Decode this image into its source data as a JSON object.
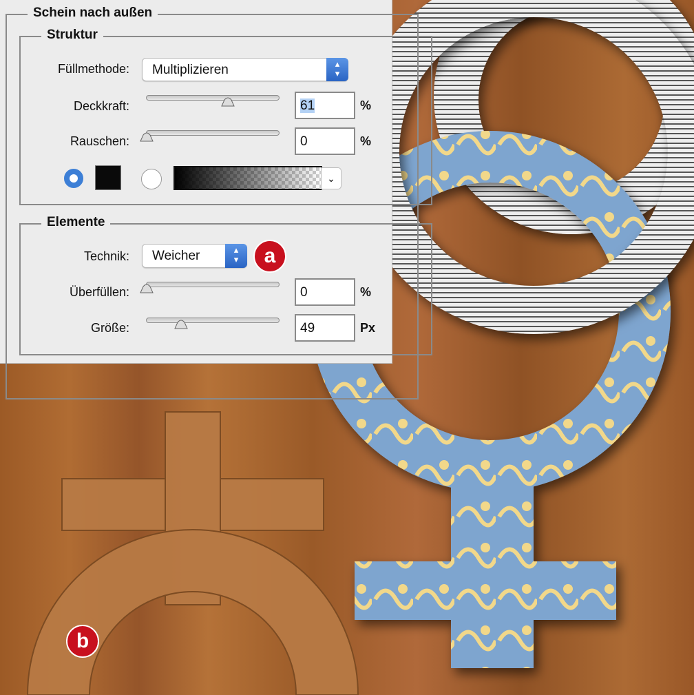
{
  "dialog": {
    "title": "Schein nach außen",
    "struktur": {
      "title": "Struktur",
      "fill_label": "Füllmethode:",
      "fill_value": "Multiplizieren",
      "opacity_label": "Deckkraft:",
      "opacity_value": "61",
      "opacity_unit": "%",
      "opacity_fraction": 0.61,
      "noise_label": "Rauschen:",
      "noise_value": "0",
      "noise_unit": "%",
      "noise_fraction": 0,
      "color_mode": "solid",
      "swatch_color": "#0a0a0a"
    },
    "elemente": {
      "title": "Elemente",
      "technique_label": "Technik:",
      "technique_value": "Weicher",
      "spread_label": "Überfüllen:",
      "spread_value": "0",
      "spread_unit": "%",
      "spread_fraction": 0,
      "size_label": "Größe:",
      "size_value": "49",
      "size_unit": "Px",
      "size_fraction": 0.26
    }
  },
  "annotations": {
    "a": "a",
    "b": "b"
  },
  "colors": {
    "accent": "#c8101e",
    "radio_blue": "#3d7fd6"
  }
}
